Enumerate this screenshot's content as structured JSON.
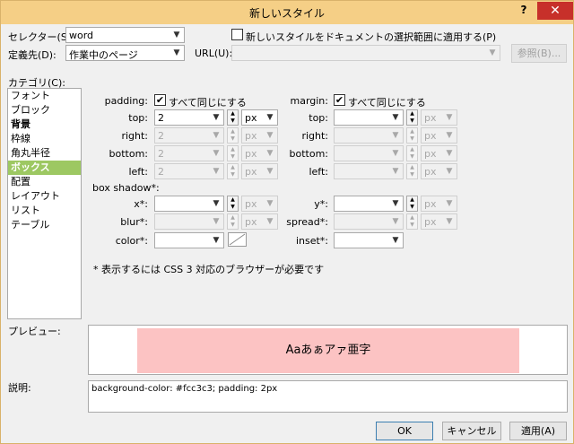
{
  "window": {
    "title": "新しいスタイル",
    "help": "?",
    "close": "✕"
  },
  "top": {
    "selector_label": "セレクター(S):",
    "selector_value": "word",
    "apply_label": "新しいスタイルをドキュメントの選択範囲に適用する(P)",
    "apply_checked": false,
    "target_label": "定義先(D):",
    "target_value": "作業中のページ",
    "url_label": "URL(U):",
    "url_value": "",
    "browse_label": "参照(B)..."
  },
  "category": {
    "label": "カテゴリ(C):",
    "items": [
      {
        "label": "フォント",
        "bold": false
      },
      {
        "label": "ブロック",
        "bold": false
      },
      {
        "label": "背景",
        "bold": true
      },
      {
        "label": "枠線",
        "bold": false
      },
      {
        "label": "角丸半径",
        "bold": false
      },
      {
        "label": "ボックス",
        "bold": true,
        "selected": true
      },
      {
        "label": "配置",
        "bold": false
      },
      {
        "label": "レイアウト",
        "bold": false
      },
      {
        "label": "リスト",
        "bold": false
      },
      {
        "label": "テーブル",
        "bold": false
      }
    ]
  },
  "box": {
    "padding_label": "padding:",
    "padding_same": "すべて同じにする",
    "margin_label": "margin:",
    "margin_same": "すべて同じにする",
    "padding": {
      "top": {
        "label": "top:",
        "value": "2",
        "unit": "px"
      },
      "right": {
        "label": "right:",
        "value": "2",
        "unit": "px"
      },
      "bottom": {
        "label": "bottom:",
        "value": "2",
        "unit": "px"
      },
      "left": {
        "label": "left:",
        "value": "2",
        "unit": "px"
      }
    },
    "margin": {
      "top": {
        "label": "top:",
        "value": "",
        "unit": "px"
      },
      "right": {
        "label": "right:",
        "value": "",
        "unit": "px"
      },
      "bottom": {
        "label": "bottom:",
        "value": "",
        "unit": "px"
      },
      "left": {
        "label": "left:",
        "value": "",
        "unit": "px"
      }
    },
    "shadow_label": "box shadow*:",
    "x_label": "x*:",
    "y_label": "y*:",
    "blur_label": "blur*:",
    "spread_label": "spread*:",
    "color_label": "color*:",
    "inset_label": "inset*:",
    "unit": "px",
    "note": "* 表示するには CSS 3 対応のブラウザーが必要です"
  },
  "preview": {
    "label": "プレビュー:",
    "sample": "Aaあぁアァ亜字",
    "bg": "#fcc3c3"
  },
  "description": {
    "label": "説明:",
    "text": "background-color: #fcc3c3; padding: 2px"
  },
  "buttons": {
    "ok": "OK",
    "cancel": "キャンセル",
    "apply": "適用(A)"
  },
  "colors": {
    "titlebar": "#f5cf86",
    "close": "#c7302a",
    "selected": "#9dc862"
  }
}
